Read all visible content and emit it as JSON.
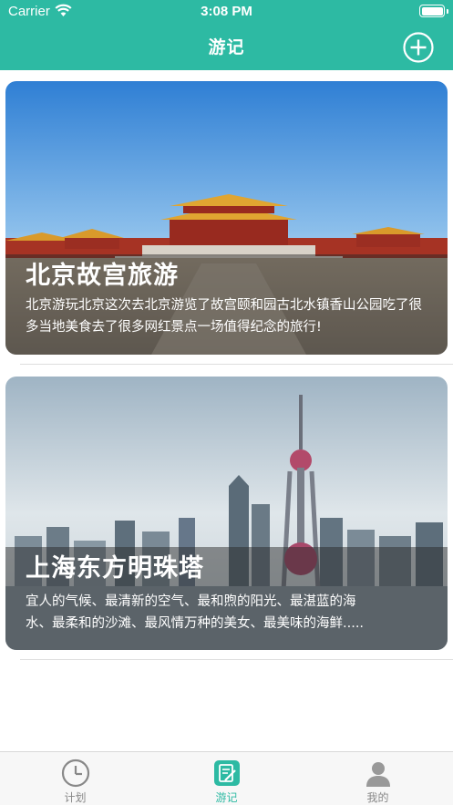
{
  "status_bar": {
    "carrier": "Carrier",
    "time": "3:08 PM"
  },
  "nav": {
    "title": "游记",
    "add_icon": "plus-circle-icon"
  },
  "cards": [
    {
      "title": "北京故宫旅游",
      "description": "北京游玩北京这次去北京游览了故宫颐和园古北水镇香山公园吃了很多当地美食去了很多网红景点一场值得纪念的旅行!",
      "image": "forbidden-city-photo"
    },
    {
      "title": "上海东方明珠塔",
      "description_lines": [
        "宜人的气候、最清新的空气、最和煦的阳光、最湛蓝的海",
        "水、最柔和的沙滩、最风情万种的美女、最美味的海鲜....."
      ],
      "image": "oriental-pearl-tower-photo"
    }
  ],
  "tabs": [
    {
      "label": "计划",
      "icon": "clock-icon",
      "active": false
    },
    {
      "label": "游记",
      "icon": "edit-note-icon",
      "active": true
    },
    {
      "label": "我的",
      "icon": "user-icon",
      "active": false
    }
  ],
  "colors": {
    "primary": "#2dbaa3",
    "tab_inactive": "#888888",
    "overlay": "rgba(40,40,40,0.48)"
  }
}
